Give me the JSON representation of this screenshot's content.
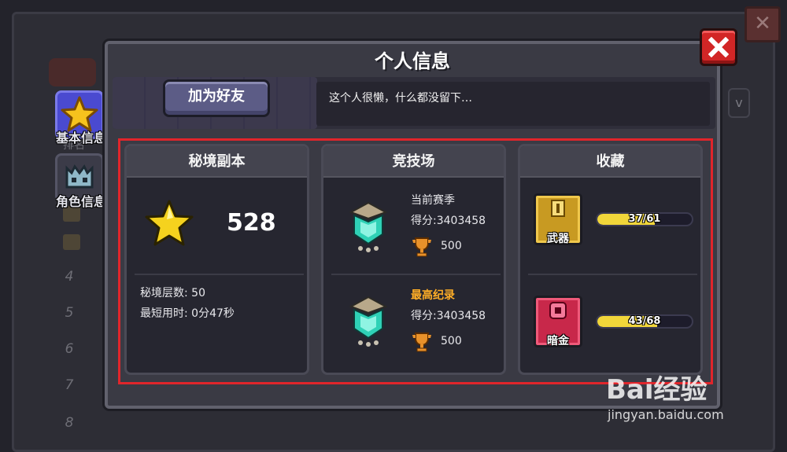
{
  "dialog": {
    "title": "个人信息",
    "add_friend_label": "加为好友",
    "bio": "这个人很懒，什么都没留下…"
  },
  "side_tabs": [
    {
      "label": "基本信息",
      "icon": "star-icon",
      "active": true
    },
    {
      "label": "角色信息",
      "icon": "helmet-icon",
      "active": false
    }
  ],
  "secret_realm": {
    "title": "秘境副本",
    "stars": "528",
    "floors_label": "秘境层数: 50",
    "best_time_label": "最短用时: 0分47秒"
  },
  "arena": {
    "title": "竞技场",
    "current": {
      "label": "当前赛季",
      "score": "得分:3403458",
      "trophies": "500"
    },
    "best": {
      "label": "最高纪录",
      "score": "得分:3403458",
      "trophies": "500"
    }
  },
  "collection": {
    "title": "收藏",
    "items": [
      {
        "label": "武器",
        "progress_text": "37/61",
        "current": 37,
        "total": 61
      },
      {
        "label": "暗金",
        "progress_text": "43/68",
        "current": 43,
        "total": 68
      }
    ]
  },
  "background": {
    "rank_numbers": [
      "4",
      "5",
      "6",
      "7",
      "8"
    ],
    "rank_label": "排名"
  },
  "watermark": {
    "brand": "Bai经验",
    "url": "jingyan.baidu.com"
  },
  "colors": {
    "accent_red": "#e0252b",
    "progress_yellow": "#f1d63a",
    "highlight_orange": "#ffae27",
    "tab_active": "#4a4ad0"
  }
}
